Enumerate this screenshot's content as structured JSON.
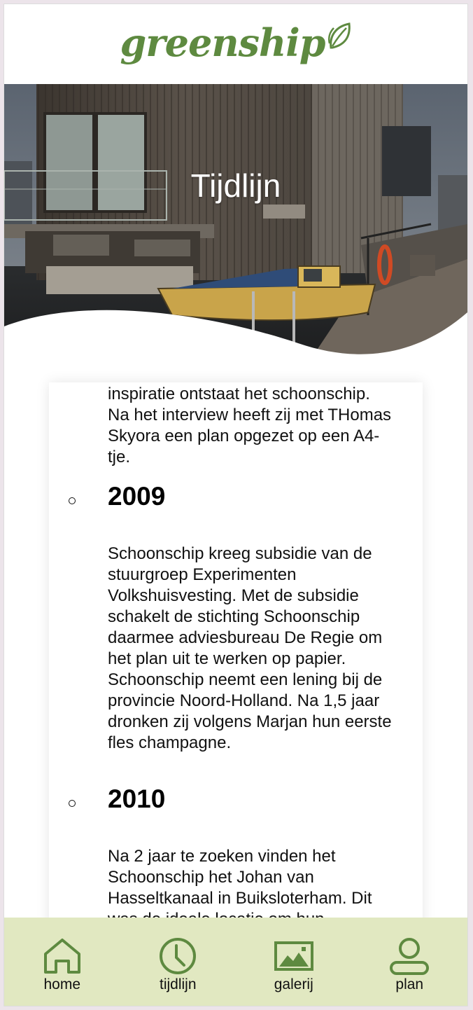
{
  "header": {
    "logo_text": "greenship"
  },
  "hero": {
    "title": "Tijdlijn"
  },
  "timeline": {
    "intro_text": "inspiratie ontstaat het schoonschip. Na het interview heeft zij met THomas Skyora een plan opgezet op een A4-tje.",
    "entries": [
      {
        "year": "2009",
        "text": "Schoonschip kreeg subsidie van de stuurgroep Experimenten Volkshuisvesting. Met de subsidie schakelt de stichting Schoonschip daarmee adviesbureau De Regie om het plan uit te werken op papier. Schoonschip neemt een lening bij de provincie Noord-Holland. Na 1,5 jaar dronken zij volgens Marjan hun eerste fles champagne."
      },
      {
        "year": "2010",
        "text": "Na 2 jaar te zoeken vinden het Schoonschip het Johan van Hasseltkanaal in Buiksloterham. Dit was de ideale locatie om hun"
      }
    ]
  },
  "nav": {
    "items": [
      {
        "label": "home",
        "icon": "home-icon"
      },
      {
        "label": "tijdlijn",
        "icon": "clock-icon"
      },
      {
        "label": "galerij",
        "icon": "image-icon"
      },
      {
        "label": "plan",
        "icon": "user-icon"
      }
    ]
  },
  "colors": {
    "brand_green": "#5e8a40",
    "nav_background": "#e1e8c1",
    "icon_green": "#5e8a40"
  }
}
